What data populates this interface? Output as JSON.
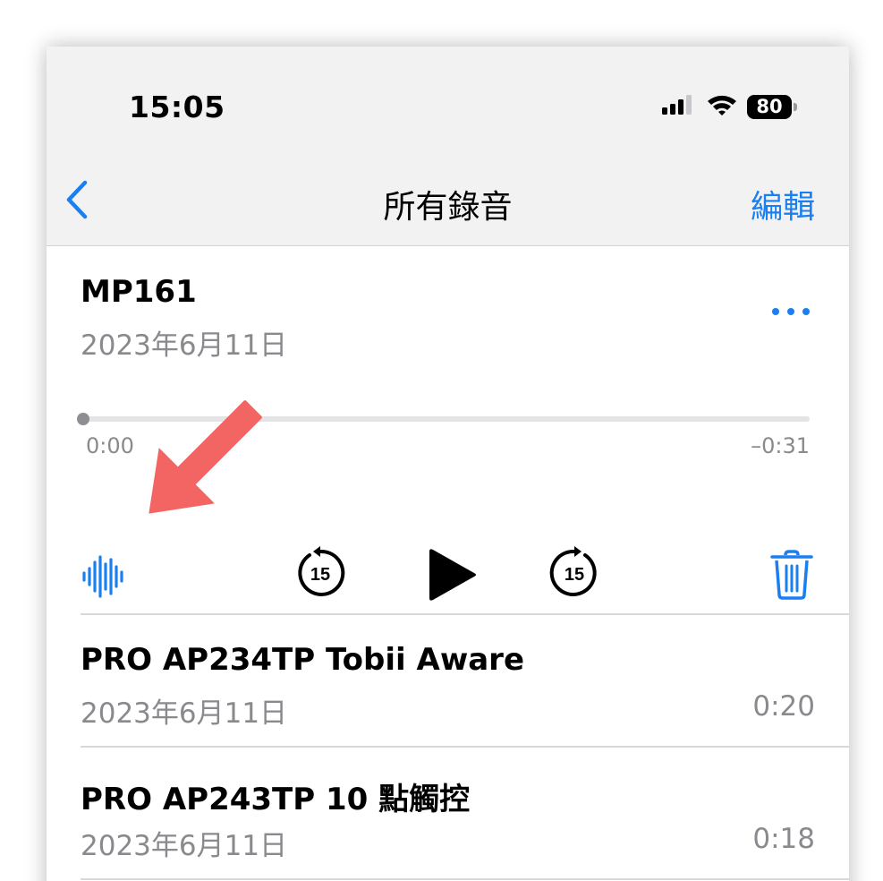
{
  "status_bar": {
    "time": "15:05",
    "battery": "80",
    "icons": [
      "cellular-signal-icon",
      "wifi-icon",
      "battery-icon"
    ]
  },
  "nav": {
    "back_icon": "chevron-left-icon",
    "title": "所有錄音",
    "edit_label": "編輯"
  },
  "current_recording": {
    "title": "MP161",
    "date": "2023年6月11日",
    "more_icon": "ellipsis-icon",
    "elapsed": "0:00",
    "remaining": "–0:31",
    "progress": 0.0
  },
  "controls": {
    "waveform_icon": "waveform-icon",
    "skip_back_icon": "skip-back-15-icon",
    "skip_back_seconds": "15",
    "play_icon": "play-icon",
    "skip_forward_icon": "skip-forward-15-icon",
    "skip_forward_seconds": "15",
    "delete_icon": "trash-icon"
  },
  "recordings": [
    {
      "title": "PRO AP234TP Tobii Aware",
      "date": "2023年6月11日",
      "duration": "0:20"
    },
    {
      "title": "PRO AP243TP 10 點觸控",
      "date": "2023年6月11日",
      "duration": "0:18"
    }
  ],
  "annotation": {
    "arrow_icon": "pointer-arrow-icon",
    "arrow_color": "#f26563"
  },
  "colors": {
    "accent": "#1a7ff0",
    "header_bg": "#f2f2f3",
    "secondary_text": "#8a8a8e"
  }
}
